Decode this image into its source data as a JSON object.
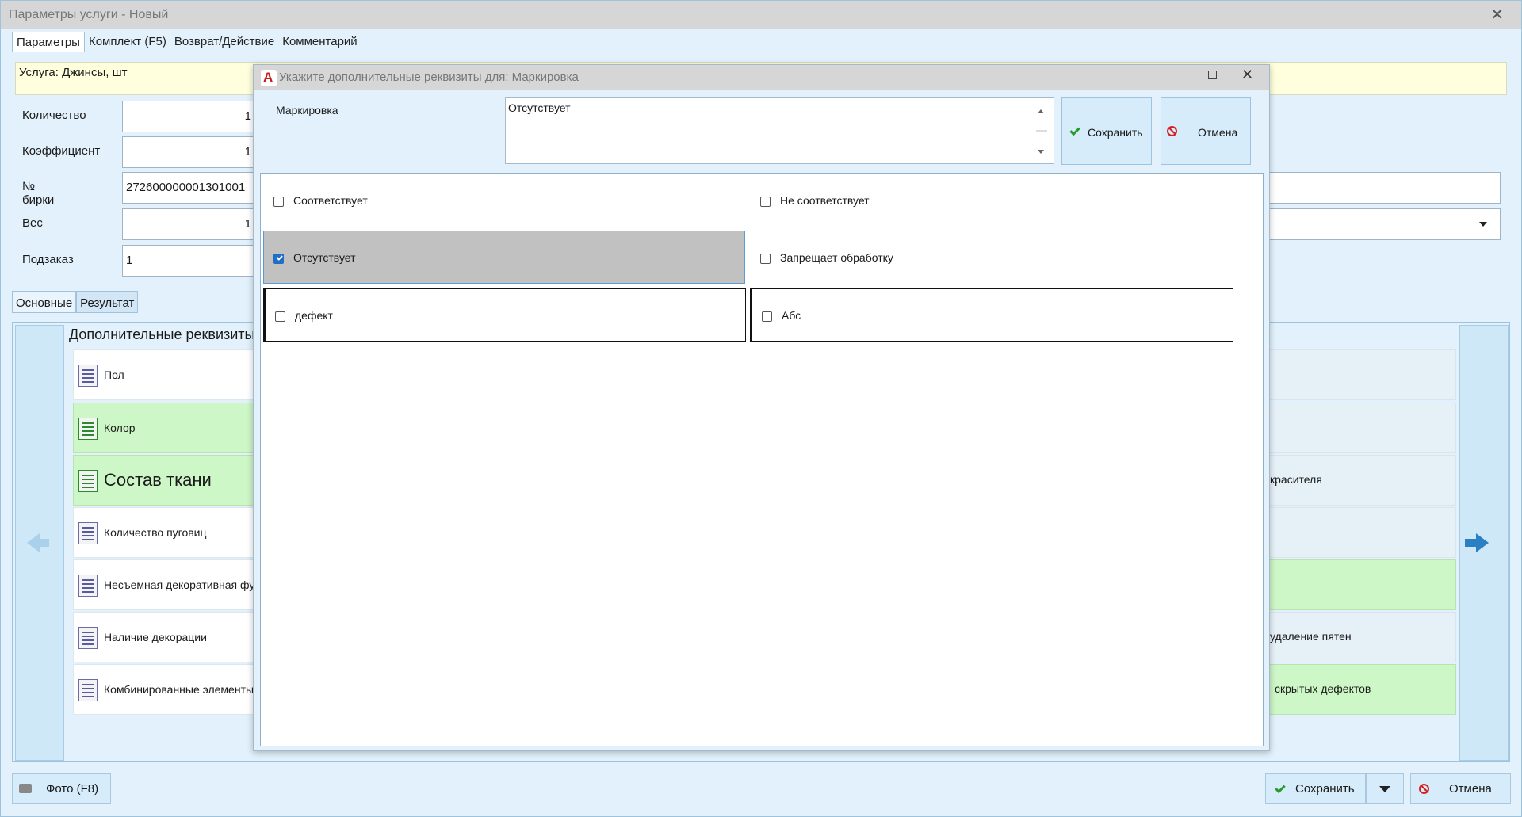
{
  "window": {
    "title": "Параметры услуги - Новый",
    "close_glyph": "✕"
  },
  "tabs": [
    "Параметры",
    "Комплект (F5)",
    "Возврат/Действие",
    "Комментарий"
  ],
  "service": "Услуга: Джинсы, шт",
  "fields": {
    "quantity": {
      "label": "Количество",
      "value": "1"
    },
    "coefficient": {
      "label": "Коэффициент",
      "value": "1"
    },
    "tag": {
      "label": "№ бирки",
      "value": "272600000001301001"
    },
    "weight": {
      "label": "Вес",
      "value": "1"
    },
    "suborder": {
      "label": "Подзаказ",
      "value": "1"
    }
  },
  "subtabs": [
    "Основные",
    "Результат"
  ],
  "additional_title": "Дополнительные реквизиты",
  "left_items": [
    {
      "label": "Пол",
      "green": false
    },
    {
      "label": "Колор",
      "green": true
    },
    {
      "label": "Состав ткани",
      "green": true
    },
    {
      "label": "Количество пуговиц",
      "green": false
    },
    {
      "label": "Несъемная декоративная фурнитура",
      "green": false
    },
    {
      "label": "Наличие декорации",
      "green": false
    },
    {
      "label": "Комбинированные элементы",
      "green": false
    }
  ],
  "right_items": [
    {
      "label": "",
      "green": false
    },
    {
      "label": "",
      "green": false
    },
    {
      "label": "красителя",
      "green": false
    },
    {
      "label": "",
      "green": false
    },
    {
      "label": "",
      "green": true
    },
    {
      "label": "удаление пятен",
      "green": false
    },
    {
      "label": "скрытых дефектов",
      "green": true
    }
  ],
  "bottom": {
    "photo": "Фото (F8)",
    "save": "Сохранить",
    "cancel": "Отмена"
  },
  "dialog": {
    "title": "Укажите дополнительные реквизиты для: Маркировка",
    "close_glyph": "✕",
    "field_label": "Маркировка",
    "field_value": "Отсутствует",
    "save": "Сохранить",
    "cancel": "Отмена",
    "options": [
      {
        "label": "Соответствует",
        "checked": false
      },
      {
        "label": "Не соответствует",
        "checked": false
      },
      {
        "label": "Отсутствует",
        "checked": true
      },
      {
        "label": "Запрещает обработку",
        "checked": false
      },
      {
        "label": "дефект",
        "checked": false
      },
      {
        "label": "Абс",
        "checked": false
      }
    ]
  },
  "colors": {
    "accent": "#2a80c3",
    "green_row": "#cdf7c6",
    "selected_option": "#c1c1c1",
    "service_bg": "#ffffde"
  },
  "icons": [
    "close-icon",
    "camera-icon",
    "check-icon",
    "cancel-icon",
    "dropdown-arrow-icon",
    "left-arrow-icon",
    "right-arrow-icon",
    "app-logo-icon",
    "maximize-icon",
    "list-icon"
  ]
}
